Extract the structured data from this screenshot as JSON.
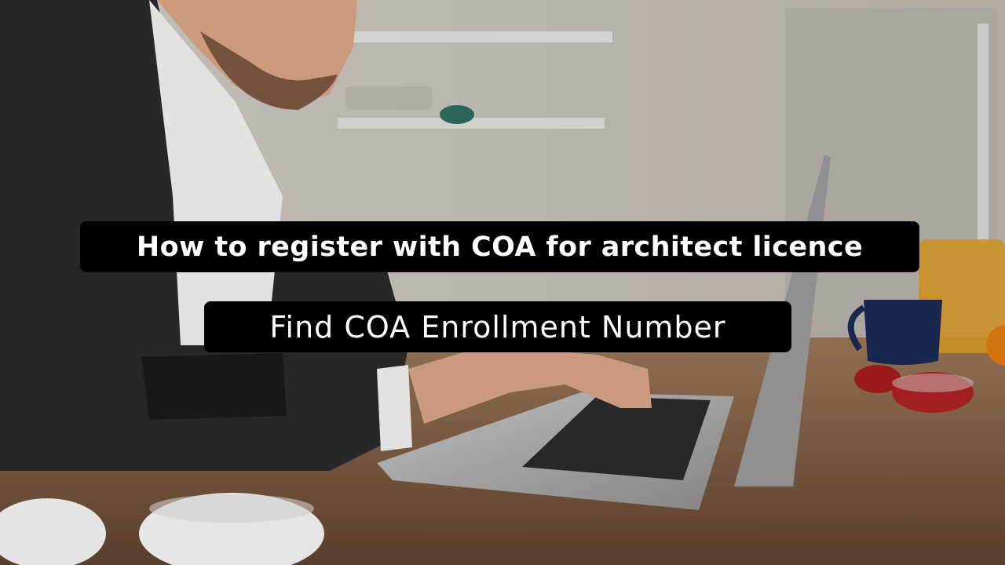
{
  "captions": {
    "title": "How to register with COA for architect licence",
    "subtitle": "Find COA Enrollment Number"
  },
  "colors": {
    "caption_background": "#000000",
    "caption_text": "#ffffff"
  }
}
